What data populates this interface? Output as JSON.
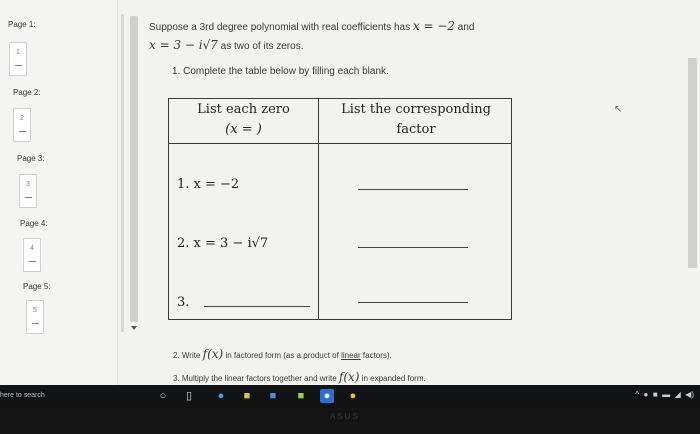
{
  "nav": {
    "pages": [
      {
        "label": "Page 1:",
        "num": "1"
      },
      {
        "label": "Page 2:",
        "num": "2"
      },
      {
        "label": "Page 3:",
        "num": "3"
      },
      {
        "label": "Page 4:",
        "num": "4"
      },
      {
        "label": "Page 5:",
        "num": "5"
      }
    ]
  },
  "problem": {
    "intro_a": "Suppose a 3rd degree polynomial with real coefficients has",
    "intro_math1": "x = −2",
    "intro_and": "and",
    "intro_math2": "x = 3 − i√7",
    "intro_b": "as two of its zeros.",
    "q1": "1. Complete the table below by filling each blank.",
    "q2_pre": "2. Write",
    "q2_math": "f(x)",
    "q2_mid": "in factored form (as a product of",
    "q2_link": "linear",
    "q2_post": "factors).",
    "q3_pre": "3. Multiply the linear factors together and write",
    "q3_math": "f(x)",
    "q3_post": "in expanded form."
  },
  "table": {
    "header1_line1": "List each zero",
    "header1_line2": "(x =   )",
    "header2_line1": "List the corresponding",
    "header2_line2": "factor",
    "rows": [
      {
        "zero": "1.  x = −2"
      },
      {
        "zero": "2.  x = 3 − i√7"
      },
      {
        "zero": "3."
      }
    ]
  },
  "taskbar": {
    "search_text": "here to search"
  },
  "bezel": {
    "brand": "ASUS"
  }
}
